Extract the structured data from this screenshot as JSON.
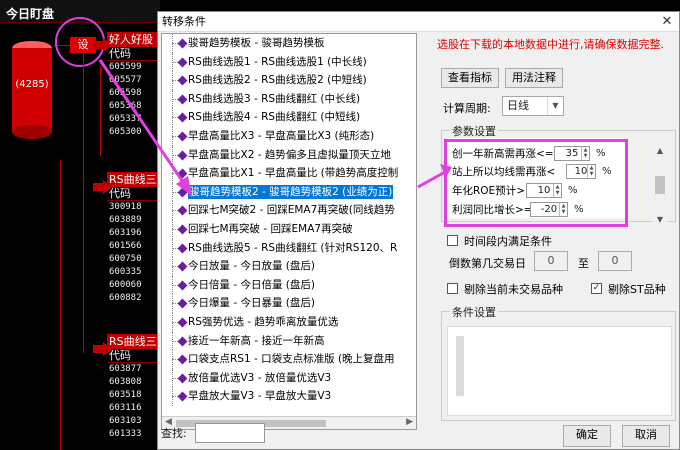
{
  "app": {
    "title": "今日盯盘",
    "cylinder_count": "(4285)",
    "set_label": "设"
  },
  "panels": [
    {
      "head": "好人好股",
      "sub": "代码",
      "rows": [
        "605599",
        "605577",
        "605598",
        "605368",
        "605337",
        "605300"
      ]
    },
    {
      "head": "RS曲线三",
      "sub": "代码",
      "rows": [
        "300918",
        "603889",
        "603196",
        "601566",
        "600750",
        "600335",
        "600060",
        "600882"
      ]
    },
    {
      "head": "RS曲线三",
      "sub": "代码",
      "rows": [
        "603877",
        "603808",
        "603518",
        "603116",
        "603103",
        "601333"
      ]
    }
  ],
  "dialog": {
    "title": "转移条件",
    "close": "✕",
    "notice": "选股在下载的本地数据中进行,请确保数据完整.",
    "buttons": {
      "view_formula": "查看指标",
      "usage": "用法注释",
      "ok": "确定",
      "cancel": "取消"
    },
    "period_label": "计算周期:",
    "period_value": "日线",
    "param_group": "参数设置",
    "params": [
      {
        "label": "创一年新高需再涨<=",
        "value": "35",
        "unit": "%"
      },
      {
        "label": "站上所以均线需再涨<",
        "value": "10",
        "unit": "%"
      },
      {
        "label": "年化ROE预计>=",
        "value": "10",
        "unit": "%"
      },
      {
        "label": "利润同比增长>=",
        "value": "-20",
        "unit": "%"
      }
    ],
    "time_range_label": "时间段内满足条件",
    "reverse_day_label": "倒数第几交易日",
    "day_from": "0",
    "to_label": "至",
    "day_to": "0",
    "exclude_untraded": "剔除当前未交易品种",
    "exclude_st": "剔除ST品种",
    "cond_group": "条件设置",
    "search_label": "查找:",
    "items": [
      "骏哥趋势模板 - 骏哥趋势模板",
      "RS曲线选股1 - RS曲线选股1 (中长线)",
      "RS曲线选股2 - RS曲线选股2 (中短线)",
      "RS曲线选股3 - RS曲线翻红 (中长线)",
      "RS曲线选股4 - RS曲线翻红 (中短线)",
      "早盘高量比X3 - 早盘高量比X3 (纯形态)",
      "早盘高量比X2 - 趋势偏多且虚拟量顶天立地",
      "早盘高量比X1 - 早盘高量比 (带趋势高度控制",
      "骏哥趋势模板2 - 骏哥趋势模板2 (业绩为正)",
      "回踩七M突破2 - 回踩EMA7再突破(同线趋势",
      "回踩七M再突破 - 回踩EMA7再突破",
      "RS曲线选股5 - RS曲线翻红 (针对RS120、R",
      "今日放量 - 今日放量 (盘后)",
      "今日倍量 - 今日倍量 (盘后)",
      "今日爆量 - 今日暴量 (盘后)",
      "RS强势优选 - 趋势乖离放量优选",
      "接近一年新高 - 接近一年新高",
      "口袋支点RS1 - 口袋支点标准版 (晚上复盘用",
      "放倍量优选V3 - 放倍量优选V3",
      "早盘放大量V3 - 早盘放大量V3"
    ],
    "selected_index": 8
  },
  "colors": {
    "accent": "#e040e0",
    "selection": "#0078d7",
    "alert": "#e00000",
    "bg_red": "#c00000"
  }
}
